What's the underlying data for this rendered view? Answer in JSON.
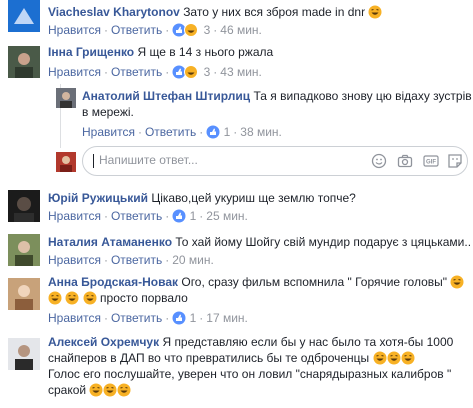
{
  "colors": {
    "link": "#385898",
    "meta": "#90949c",
    "like_blue": "#5890ff",
    "haha_yellow": "#f7b125"
  },
  "actions": {
    "like": "Нравится",
    "reply": "Ответить",
    "sep": "·"
  },
  "comments": [
    {
      "name": "Viacheslav Kharytonov",
      "text": "Зато у них вся зброя made in dnr",
      "count": "3",
      "time": "46 мин."
    },
    {
      "name": "Інна Грищенко",
      "text": "Я ще в 14 з нього ржала",
      "count": "3",
      "time": "43 мин."
    },
    {
      "name": "Анатолий Штефан Штирлиц",
      "text1": "Та я випадково знову цю відаху зустрів",
      "text2": "в мережі.",
      "count": "1",
      "time": "38 мин."
    },
    {
      "name": "Юрій Ружицький",
      "text": "Цікаво,цей укуриш ще землю топче?",
      "count": "1",
      "time": "25 мин."
    },
    {
      "name": "Наталия Атаманенко",
      "text": "То хай йому Шойгу свій мундир подарує з цяцьками..",
      "time": "20 мин."
    },
    {
      "name": "Анна Бродская-Новак",
      "text1": "Ого, сразу фильм вспомнила \" Горячие головы\"",
      "text2": "просто порвало",
      "count": "1",
      "time": "17 мин."
    },
    {
      "name": "Алексей Охремчук",
      "text1": "Я представляю если бы у нас было та хотя-бы 1000",
      "text2": "снайперов в ДАП во что превратились бы те одброченцы",
      "text3": "Голос его послушайте, уверен что он ловил \"снарядыразных калибров \"",
      "text4": "сракой"
    }
  ],
  "reply_box": {
    "placeholder": "Напишите ответ..."
  },
  "icons": [
    "smile-icon",
    "camera-icon",
    "gif-icon",
    "sticker-icon"
  ]
}
